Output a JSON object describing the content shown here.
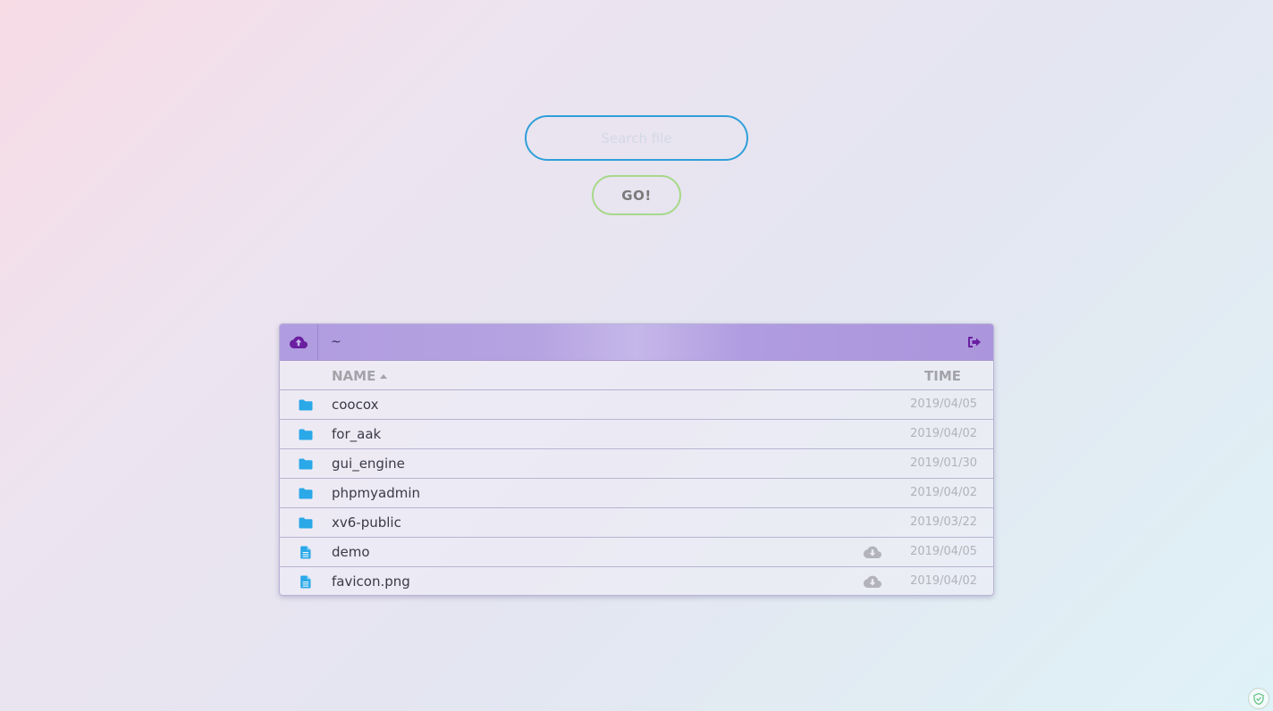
{
  "search": {
    "placeholder": "Search file",
    "value": ""
  },
  "go_button": {
    "label": "GO!"
  },
  "panel": {
    "path": "~",
    "columns": {
      "name": "NAME",
      "time": "TIME"
    },
    "rows": [
      {
        "name": "coocox",
        "time": "2019/04/05",
        "type": "folder"
      },
      {
        "name": "for_aak",
        "time": "2019/04/02",
        "type": "folder"
      },
      {
        "name": "gui_engine",
        "time": "2019/01/30",
        "type": "folder"
      },
      {
        "name": "phpmyadmin",
        "time": "2019/04/02",
        "type": "folder"
      },
      {
        "name": "xv6-public",
        "time": "2019/03/22",
        "type": "folder"
      },
      {
        "name": "demo",
        "time": "2019/04/05",
        "type": "file"
      },
      {
        "name": "favicon.png",
        "time": "2019/04/02",
        "type": "file"
      }
    ]
  },
  "icons": {
    "upload": "cloud-upload-icon",
    "logout": "sign-out-icon",
    "folder": "folder-icon",
    "file": "file-icon",
    "download": "cloud-download-icon",
    "sort": "sort-asc-icon",
    "badge": "shield-check-icon"
  },
  "colors": {
    "search_border": "#2f9fd8",
    "go_border": "#a8d88a",
    "header_bg": "#b09ce0",
    "accent_purple": "#6a1fa0",
    "folder_blue": "#2aa8e8"
  }
}
